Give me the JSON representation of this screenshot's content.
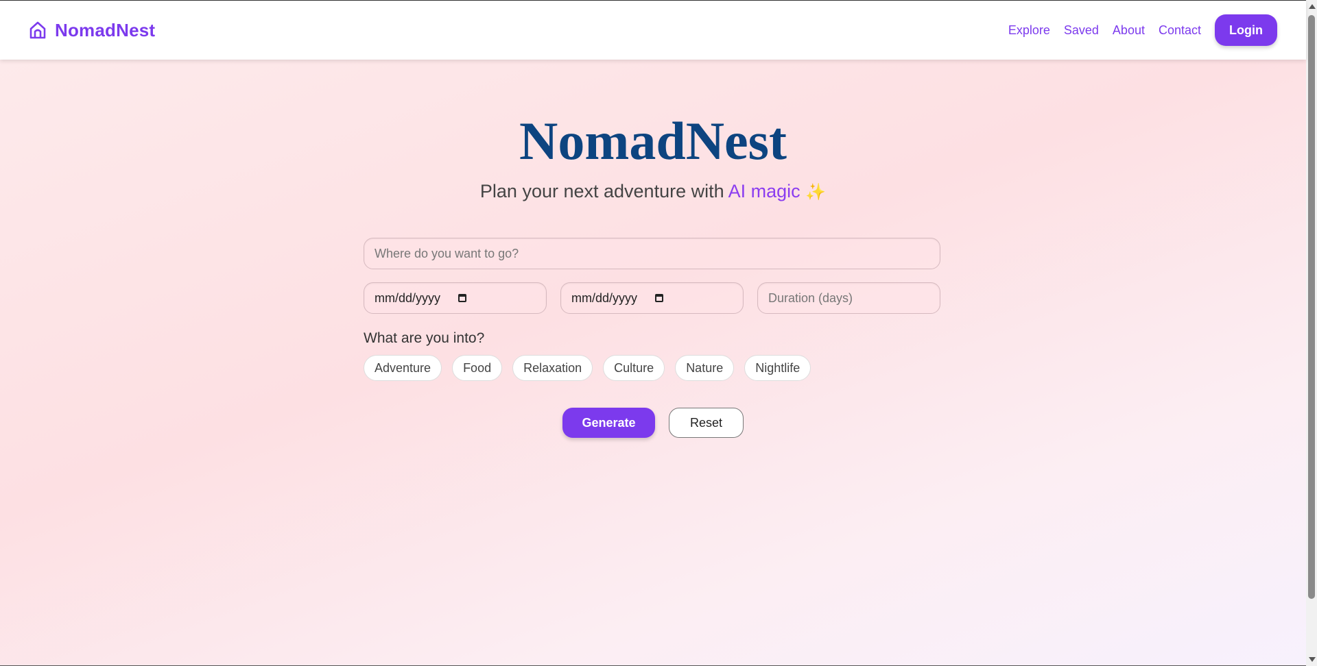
{
  "brand": {
    "name": "NomadNest",
    "icon": "home-icon",
    "color": "#7c3aed"
  },
  "nav": {
    "links": [
      "Explore",
      "Saved",
      "About",
      "Contact"
    ],
    "login_label": "Login"
  },
  "hero": {
    "title": "NomadNest",
    "subtitle_prefix": "Plan your next adventure with ",
    "subtitle_accent": "AI magic",
    "subtitle_emoji": "✨"
  },
  "form": {
    "destination_placeholder": "Where do you want to go?",
    "start_date_placeholder": "mm/dd/yyyy",
    "end_date_placeholder": "mm/dd/yyyy",
    "duration_placeholder": "Duration (days)",
    "interests_label": "What are you into?",
    "interests": [
      "Adventure",
      "Food",
      "Relaxation",
      "Culture",
      "Nature",
      "Nightlife"
    ],
    "generate_label": "Generate",
    "reset_label": "Reset"
  },
  "colors": {
    "accent": "#7c3aed",
    "title": "#0d4480"
  }
}
